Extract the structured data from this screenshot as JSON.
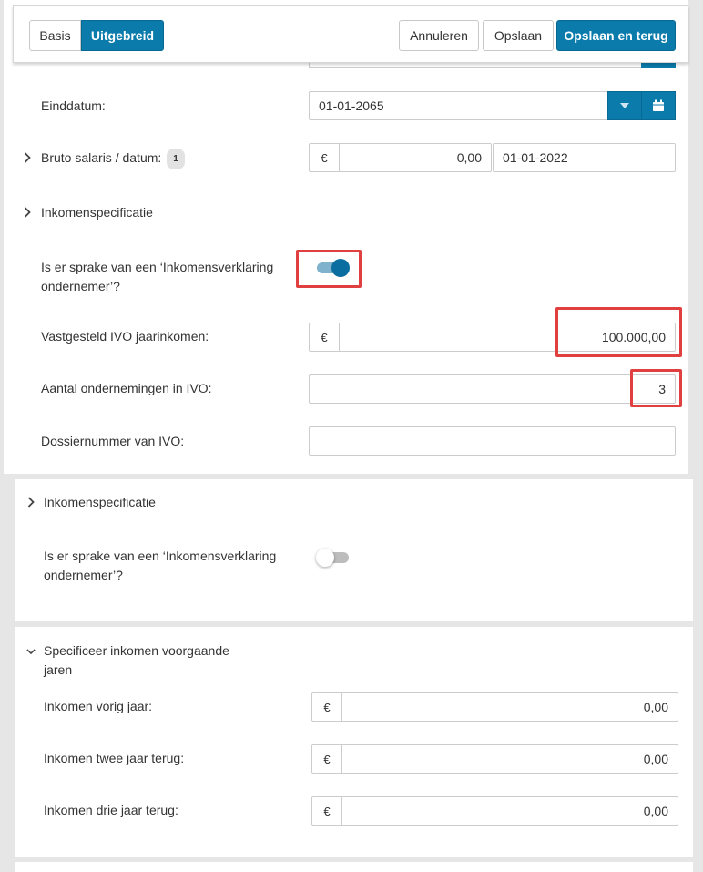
{
  "toolbar": {
    "mode_basic": "Basis",
    "mode_advanced": "Uitgebreid",
    "cancel": "Annuleren",
    "save": "Opslaan",
    "save_back": "Opslaan en terug"
  },
  "section1": {
    "enddate_label": "Einddatum:",
    "enddate_value": "01-01-2065",
    "gross_salary_label": "Bruto salaris / datum:",
    "gross_salary_badge": "1",
    "currency": "€",
    "gross_salary_value": "0,00",
    "gross_salary_date": "01-01-2022",
    "income_spec_label": "Inkomenspecificatie",
    "ivo_question_line1": "Is er sprake van een ‘Inkomensverklaring",
    "ivo_question_line2": "ondernemer’?",
    "ivo_toggle_on": true,
    "ivo_income_label": "Vastgesteld IVO jaarinkomen:",
    "ivo_income_value": "100.000,00",
    "companies_label": "Aantal ondernemingen in IVO:",
    "companies_value": "3",
    "dossier_label": "Dossiernummer van IVO:",
    "dossier_value": ""
  },
  "section2": {
    "income_spec_label": "Inkomenspecificatie",
    "ivo_question_line1": "Is er sprake van een ‘Inkomensverklaring",
    "ivo_question_line2": "ondernemer’?",
    "ivo_toggle_on": false
  },
  "section3": {
    "title_line1": "Specificeer inkomen voorgaande",
    "title_line2": "jaren",
    "currency": "€",
    "rows": [
      {
        "label": "Inkomen vorig jaar:",
        "value": "0,00"
      },
      {
        "label": "Inkomen twee jaar terug:",
        "value": "0,00"
      },
      {
        "label": "Inkomen drie jaar terug:",
        "value": "0,00"
      }
    ]
  },
  "colors": {
    "primary": "#0a7bab",
    "highlight": "#e04040",
    "toggle_on": "#0a6ea0"
  }
}
